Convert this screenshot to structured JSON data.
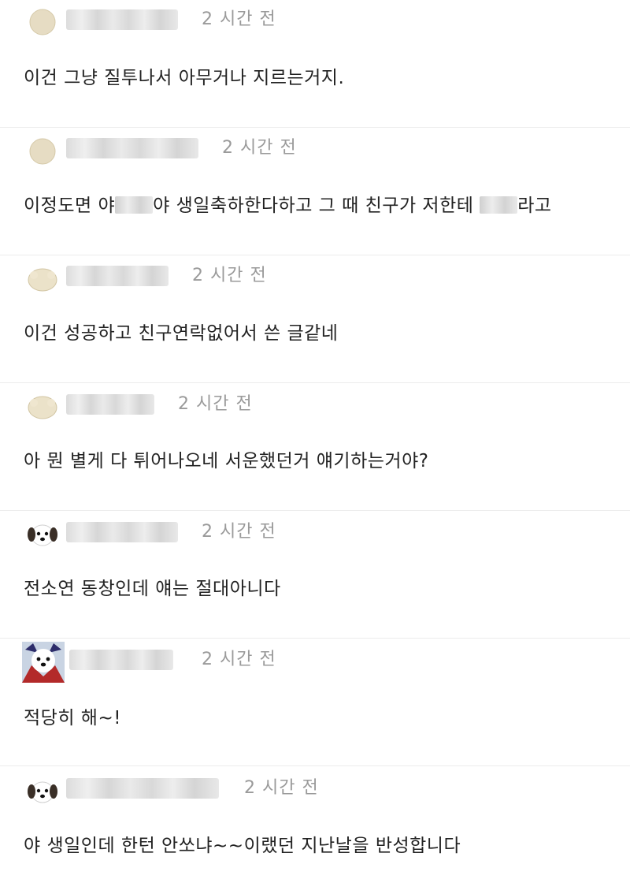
{
  "comments": [
    {
      "time": "2 시간 전",
      "avatar": "circle-avatar-icon",
      "text": "이건 그냥 질투나서 아무거나 지르는거지."
    },
    {
      "time": "2 시간 전",
      "avatar": "circle-avatar-icon",
      "text_a": "이정도면 야",
      "text_b": "야 생일축하한다하고 그 때 친구가 저한테",
      "text_c": "라고"
    },
    {
      "time": "2 시간 전",
      "avatar": "bun-avatar-icon",
      "text": "이건 성공하고 친구연락없어서 쓴 글같네"
    },
    {
      "time": "2 시간 전",
      "avatar": "bun-avatar-icon",
      "text": "아 뭔 별게 다 튀어나오네 서운했던거 얘기하는거야?"
    },
    {
      "time": "2 시간 전",
      "avatar": "puppy-avatar-icon",
      "text": "전소연 동창인데 얘는 절대아니다"
    },
    {
      "time": "2 시간 전",
      "avatar": "dog-avatar-icon",
      "text": "적당히 해~!"
    },
    {
      "time": "2 시간 전",
      "avatar": "puppy-avatar-icon",
      "text": "야 생일인데 한턴 안쏘냐~~이랬던 지난날을 반성합니다"
    }
  ]
}
